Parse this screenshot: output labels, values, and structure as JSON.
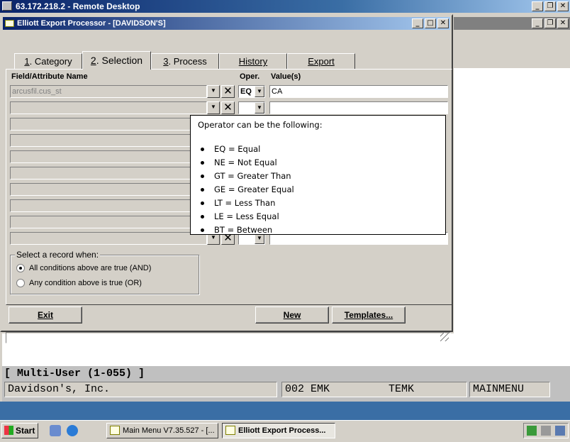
{
  "remote_desktop": {
    "title": "63.172.218.2 - Remote Desktop"
  },
  "elliott": {
    "title": "Elliott Export Processor - [DAVIDSON'S]",
    "tabs": [
      {
        "num": "1",
        "label": ". Category"
      },
      {
        "num": "2",
        "label": ". Selection"
      },
      {
        "num": "3",
        "label": ". Process"
      },
      {
        "num": "",
        "label": "History"
      },
      {
        "num": "",
        "label": "Export"
      }
    ],
    "headers": {
      "field": "Field/Attribute Name",
      "oper": "Oper.",
      "values": "Value(s)"
    },
    "rows": [
      {
        "field": "arcusfil.cus_st",
        "oper": "EQ",
        "value": "CA"
      },
      {
        "field": "",
        "oper": "",
        "value": ""
      },
      {
        "field": "",
        "oper": "",
        "value": ""
      },
      {
        "field": "",
        "oper": "",
        "value": ""
      },
      {
        "field": "",
        "oper": "",
        "value": ""
      },
      {
        "field": "",
        "oper": "",
        "value": ""
      },
      {
        "field": "",
        "oper": "",
        "value": ""
      },
      {
        "field": "",
        "oper": "",
        "value": ""
      },
      {
        "field": "",
        "oper": "",
        "value": ""
      },
      {
        "field": "",
        "oper": "",
        "value": ""
      }
    ],
    "select_group": {
      "legend": "Select a record when:",
      "options": [
        {
          "label": "All conditions above are true (AND)",
          "selected": true
        },
        {
          "label": "Any condition above is true (OR)",
          "selected": false
        }
      ]
    },
    "buttons": {
      "exit": "Exit",
      "new": "New",
      "templates": "Templates..."
    }
  },
  "tooltip": {
    "heading": "Operator can be the following:",
    "items": [
      "EQ = Equal",
      "NE = Not Equal",
      "GT = Greater Than",
      "GE = Greater Equal",
      "LT = Less Than",
      "LE = Less Equal",
      "BT = Between"
    ]
  },
  "main_menu": {
    "multi_user": "[ Multi-User (1-055) ]",
    "company": "Davidson's, Inc.",
    "code": "002 EMK",
    "user": "TEMK",
    "menu": "MAINMENU"
  },
  "taskbar": {
    "start": "Start",
    "tasks": [
      {
        "label": "Main Menu V7.35.527 - [..."
      },
      {
        "label": "Elliott Export Process..."
      }
    ]
  },
  "colors": {
    "desktop": "#3a6ea5",
    "active_title": "#0a246a",
    "face": "#d4d0c8"
  }
}
